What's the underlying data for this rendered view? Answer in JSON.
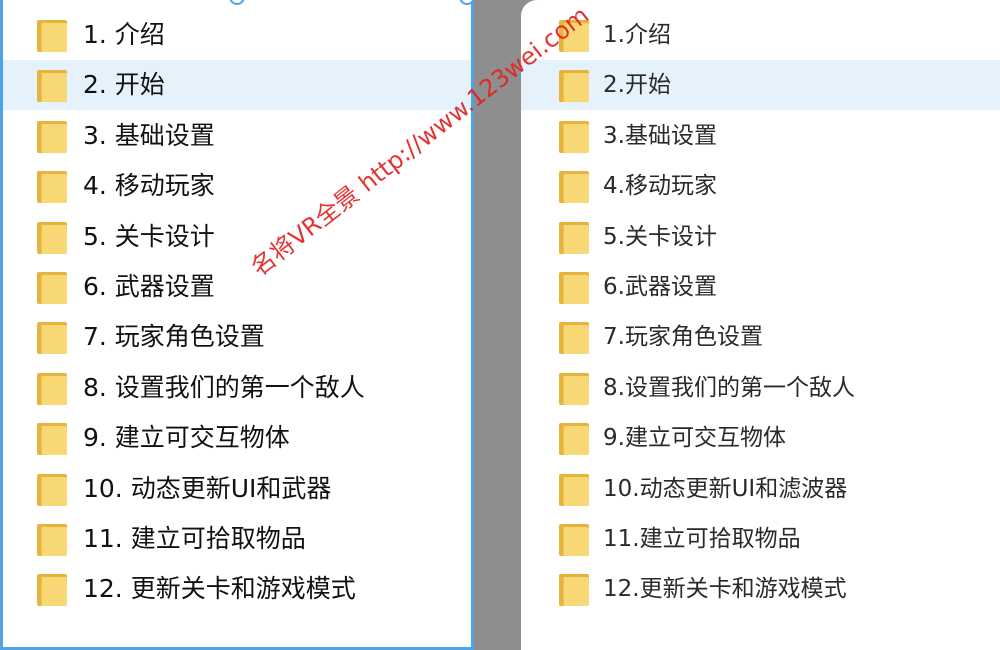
{
  "left_pane": {
    "items": [
      {
        "label": "1. 介绍"
      },
      {
        "label": "2. 开始"
      },
      {
        "label": "3. 基础设置"
      },
      {
        "label": "4. 移动玩家"
      },
      {
        "label": "5. 关卡设计"
      },
      {
        "label": "6. 武器设置"
      },
      {
        "label": "7. 玩家角色设置"
      },
      {
        "label": "8. 设置我们的第一个敌人"
      },
      {
        "label": "9. 建立可交互物体"
      },
      {
        "label": "10. 动态更新UI和武器"
      },
      {
        "label": "11. 建立可拾取物品"
      },
      {
        "label": "12. 更新关卡和游戏模式"
      }
    ],
    "selected_index": 1
  },
  "right_pane": {
    "items": [
      {
        "label": "1.介绍"
      },
      {
        "label": "2.开始"
      },
      {
        "label": "3.基础设置"
      },
      {
        "label": "4.移动玩家"
      },
      {
        "label": "5.关卡设计"
      },
      {
        "label": "6.武器设置"
      },
      {
        "label": "7.玩家角色设置"
      },
      {
        "label": "8.设置我们的第一个敌人"
      },
      {
        "label": "9.建立可交互物体"
      },
      {
        "label": "10.动态更新UI和滤波器"
      },
      {
        "label": "11.建立可拾取物品"
      },
      {
        "label": "12.更新关卡和游戏模式"
      }
    ],
    "selected_index": 1
  },
  "watermark": {
    "text": "名将VR全景 http://www.123wei.com"
  },
  "icons": {
    "folder": "folder-icon"
  },
  "colors": {
    "selection_border": "#4ea2ea",
    "row_highlight": "#e5f1fb",
    "folder_light": "#f8d775",
    "folder_dark": "#e6b43c",
    "watermark": "#e32222",
    "background": "#8e8e8e"
  }
}
